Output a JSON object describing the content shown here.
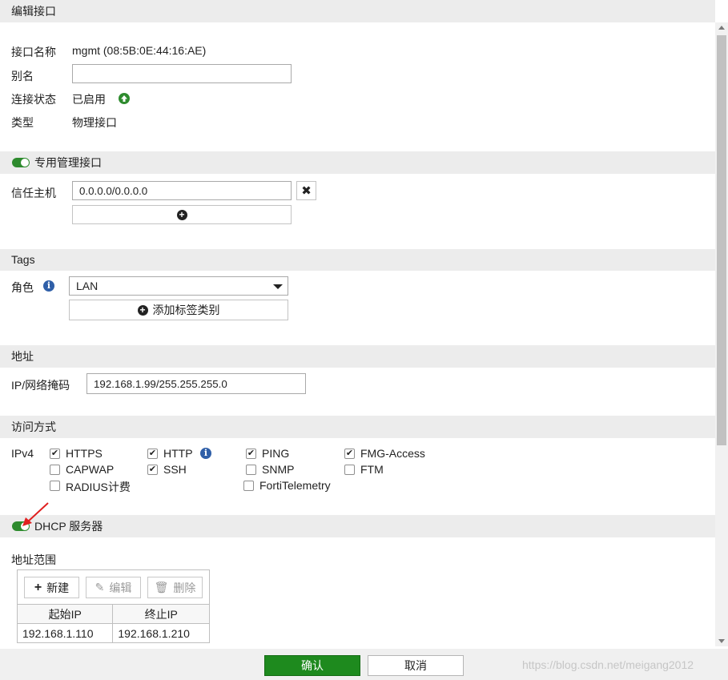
{
  "title": "编辑接口",
  "interface": {
    "name_label": "接口名称",
    "name_value": "mgmt (08:5B:0E:44:16:AE)",
    "alias_label": "别名",
    "alias_value": "",
    "link_label": "连接状态",
    "link_value": "已启用",
    "type_label": "类型",
    "type_value": "物理接口"
  },
  "dedicated_mgmt": {
    "header": "专用管理接口",
    "trusted_label": "信任主机",
    "trusted_value": "0.0.0.0/0.0.0.0"
  },
  "tags": {
    "header": "Tags",
    "role_label": "角色",
    "role_value": "LAN",
    "add_tag_label": "添加标签类别"
  },
  "address": {
    "header": "地址",
    "ip_label": "IP/网络掩码",
    "ip_value": "192.168.1.99/255.255.255.0"
  },
  "access": {
    "header": "访问方式",
    "ipv4_label": "IPv4",
    "options": [
      {
        "label": "HTTPS",
        "checked": true
      },
      {
        "label": "HTTP",
        "checked": true
      },
      {
        "label": "PING",
        "checked": true
      },
      {
        "label": "FMG-Access",
        "checked": true
      },
      {
        "label": "CAPWAP",
        "checked": false
      },
      {
        "label": "SSH",
        "checked": true
      },
      {
        "label": "SNMP",
        "checked": false
      },
      {
        "label": "FTM",
        "checked": false
      },
      {
        "label": "RADIUS计费",
        "checked": false
      },
      {
        "label": "FortiTelemetry",
        "checked": false
      }
    ]
  },
  "dhcp": {
    "header": "DHCP 服务器",
    "range_label": "地址范围",
    "new_label": "新建",
    "edit_label": "编辑",
    "delete_label": "删除",
    "columns": [
      "起始IP",
      "终止IP"
    ],
    "rows": [
      [
        "192.168.1.110",
        "192.168.1.210"
      ]
    ]
  },
  "footer": {
    "ok_label": "确认",
    "cancel_label": "取消"
  },
  "watermark": "https://blog.csdn.net/meigang2012",
  "colors": {
    "accent_green": "#1e8a1e",
    "pointer_red": "#e02020"
  }
}
